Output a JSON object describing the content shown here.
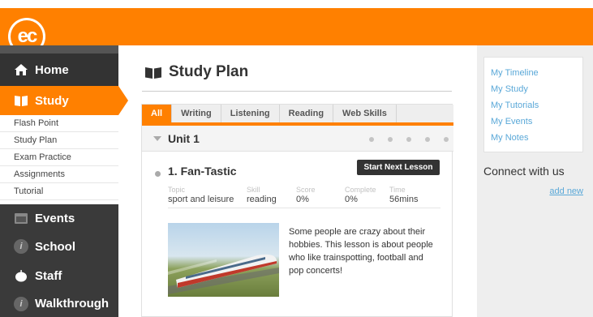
{
  "brand": {
    "logo_text": "ec",
    "accent": "#ff8000"
  },
  "sidebar": {
    "home": "Home",
    "study": "Study",
    "study_items": [
      "Flash Point",
      "Study Plan",
      "Exam Practice",
      "Assignments",
      "Tutorial"
    ],
    "events": "Events",
    "school": "School",
    "staff": "Staff",
    "walkthrough": "Walkthrough"
  },
  "main": {
    "title": "Study Plan",
    "tabs": [
      "All",
      "Writing",
      "Listening",
      "Reading",
      "Web Skills"
    ],
    "active_tab": "All",
    "unit": {
      "title": "Unit 1",
      "progress_dots": 5
    },
    "lesson": {
      "title": "1. Fan-Tastic",
      "start_button": "Start Next Lesson",
      "meta_labels": [
        "Topic",
        "Skill",
        "Score",
        "Complete",
        "Time"
      ],
      "meta_values": [
        "sport and leisure",
        "reading",
        "0%",
        "0%",
        "56mins"
      ],
      "image_alt": "high-speed train",
      "description": "Some people are crazy about their hobbies. This lesson is about people who like trainspotting, football and pop concerts!"
    }
  },
  "rightcol": {
    "links": [
      "My Timeline",
      "My Study",
      "My Tutorials",
      "My Events",
      "My Notes"
    ],
    "connect_title": "Connect with us",
    "add_new": "add new"
  }
}
